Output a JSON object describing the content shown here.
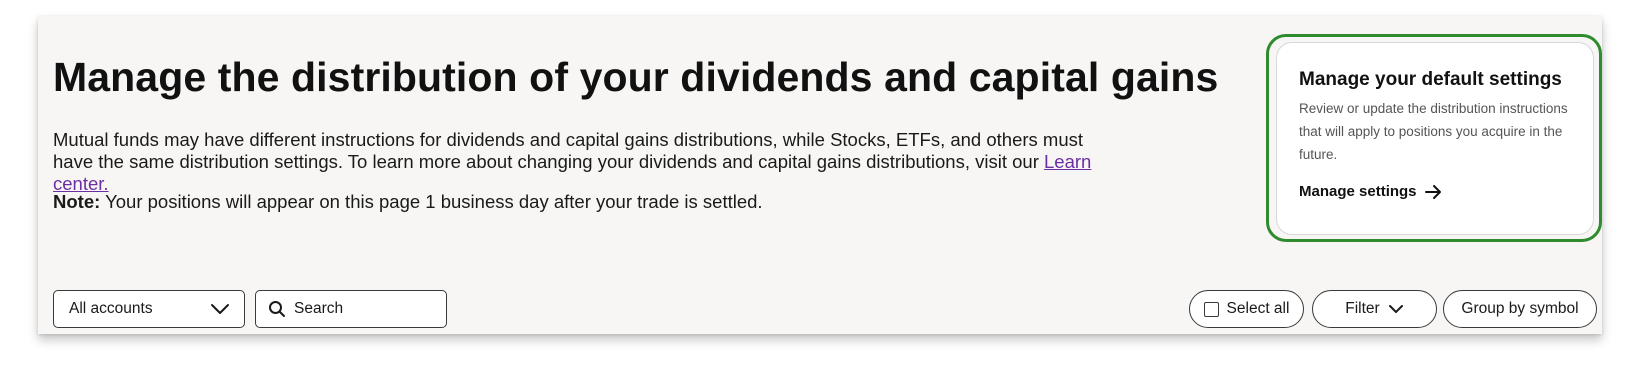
{
  "header": {
    "title": "Manage the distribution of your dividends and capital gains",
    "description": "Mutual funds may have different instructions for dividends and capital gains distributions, while Stocks, ETFs, and others must have the same distribution settings. To learn more about changing your dividends and capital gains distributions, visit our",
    "learn_link": "Learn center.",
    "note_label": "Note:",
    "note_text": "Your positions will appear on this page 1 business day after your trade is settled."
  },
  "settings_card": {
    "title": "Manage your default settings",
    "text": "Review or update the distribution instructions that will apply to positions you acquire in the future.",
    "link_label": "Manage settings",
    "highlight_color": "#2e8b2e"
  },
  "toolbar": {
    "accounts_selected": "All accounts",
    "search_placeholder": "Search",
    "select_all_label": "Select all",
    "filter_label": "Filter",
    "group_label": "Group by symbol"
  },
  "colors": {
    "link": "#6b2fa3",
    "panel_bg": "#f7f6f4"
  }
}
